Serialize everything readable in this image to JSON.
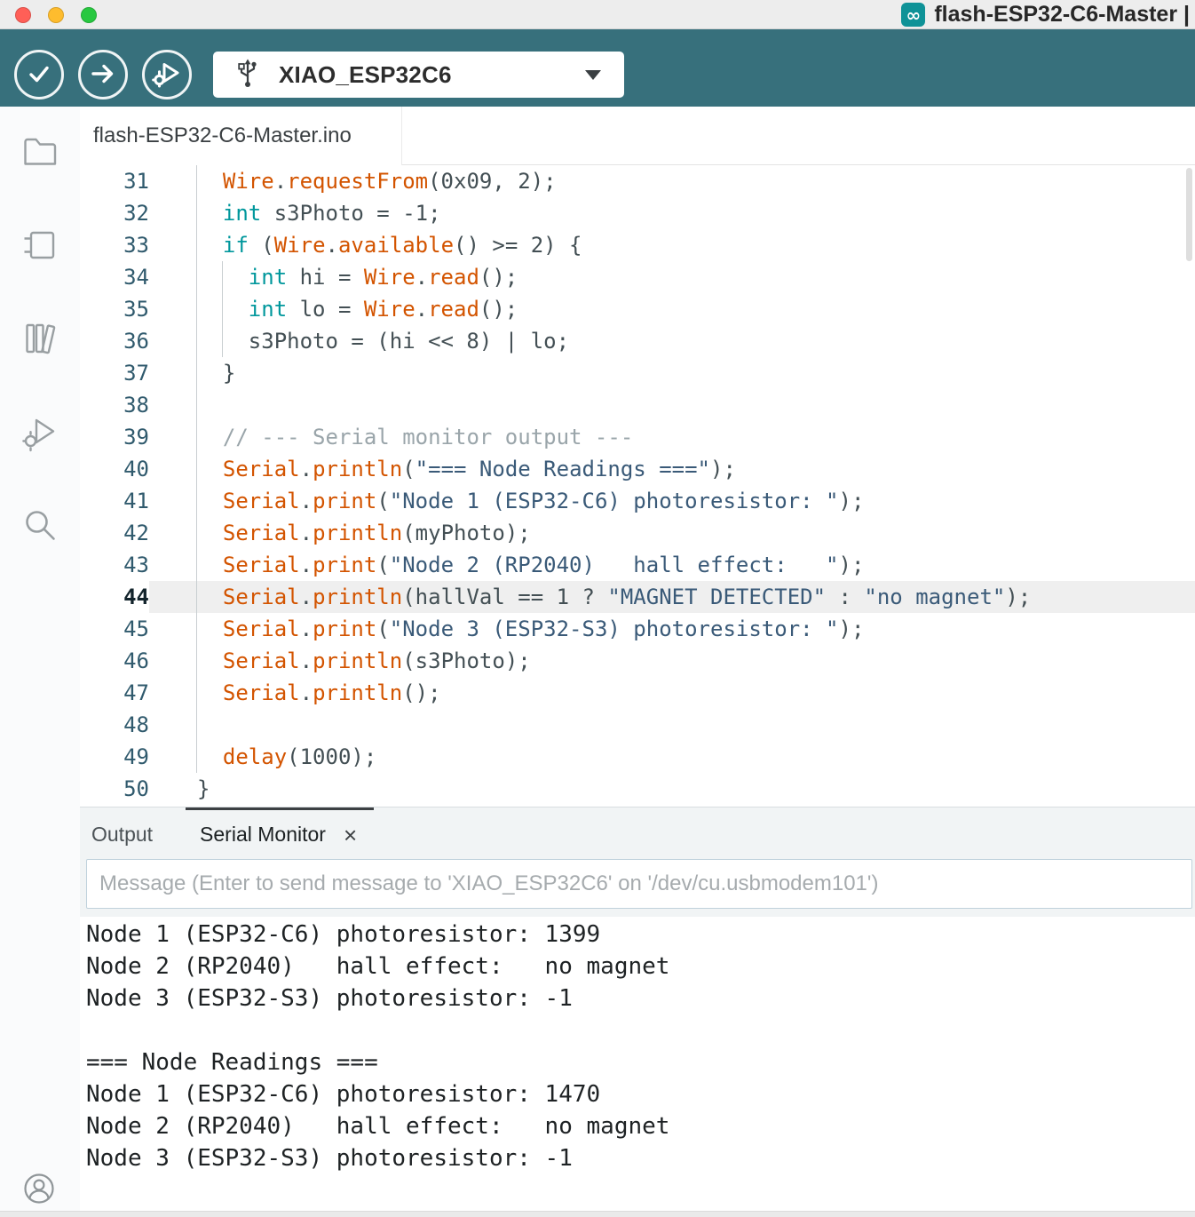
{
  "titlebar": {
    "title": "flash-ESP32-C6-Master |",
    "logo_glyph": "∞"
  },
  "toolbar": {
    "verify_label": "Verify",
    "upload_label": "Upload",
    "debug_label": "Start Debugging",
    "board_selector": {
      "value": "XIAO_ESP32C6"
    }
  },
  "activity_bar": {
    "items": [
      "sketchbook",
      "boards-manager",
      "library-manager",
      "debugger",
      "search"
    ],
    "bottom_item": "profile"
  },
  "editor": {
    "tab_title": "flash-ESP32-C6-Master.ino",
    "active_line": 44,
    "lines": [
      {
        "no": 31,
        "segs": [
          [
            "p",
            "  "
          ],
          [
            "o",
            "Wire"
          ],
          [
            "p",
            "."
          ],
          [
            "o",
            "requestFrom"
          ],
          [
            "p",
            "(0x09, 2);"
          ]
        ]
      },
      {
        "no": 32,
        "segs": [
          [
            "p",
            "  "
          ],
          [
            "k",
            "int"
          ],
          [
            "p",
            " s3Photo = -1;"
          ]
        ]
      },
      {
        "no": 33,
        "segs": [
          [
            "p",
            "  "
          ],
          [
            "k",
            "if"
          ],
          [
            "p",
            " ("
          ],
          [
            "o",
            "Wire"
          ],
          [
            "p",
            "."
          ],
          [
            "o",
            "available"
          ],
          [
            "p",
            "() >= 2) {"
          ]
        ]
      },
      {
        "no": 34,
        "segs": [
          [
            "p",
            "    "
          ],
          [
            "k",
            "int"
          ],
          [
            "p",
            " hi = "
          ],
          [
            "o",
            "Wire"
          ],
          [
            "p",
            "."
          ],
          [
            "o",
            "read"
          ],
          [
            "p",
            "();"
          ]
        ]
      },
      {
        "no": 35,
        "segs": [
          [
            "p",
            "    "
          ],
          [
            "k",
            "int"
          ],
          [
            "p",
            " lo = "
          ],
          [
            "o",
            "Wire"
          ],
          [
            "p",
            "."
          ],
          [
            "o",
            "read"
          ],
          [
            "p",
            "();"
          ]
        ]
      },
      {
        "no": 36,
        "segs": [
          [
            "p",
            "    s3Photo = (hi << 8) | lo;"
          ]
        ]
      },
      {
        "no": 37,
        "segs": [
          [
            "p",
            "  }"
          ]
        ]
      },
      {
        "no": 38,
        "segs": []
      },
      {
        "no": 39,
        "segs": [
          [
            "p",
            "  "
          ],
          [
            "c",
            "// --- Serial monitor output ---"
          ]
        ]
      },
      {
        "no": 40,
        "segs": [
          [
            "p",
            "  "
          ],
          [
            "o",
            "Serial"
          ],
          [
            "p",
            "."
          ],
          [
            "o",
            "println"
          ],
          [
            "p",
            "("
          ],
          [
            "s",
            "\"=== Node Readings ===\""
          ],
          [
            "p",
            ");"
          ]
        ]
      },
      {
        "no": 41,
        "segs": [
          [
            "p",
            "  "
          ],
          [
            "o",
            "Serial"
          ],
          [
            "p",
            "."
          ],
          [
            "o",
            "print"
          ],
          [
            "p",
            "("
          ],
          [
            "s",
            "\"Node 1 (ESP32-C6) photoresistor: \""
          ],
          [
            "p",
            ");"
          ]
        ]
      },
      {
        "no": 42,
        "segs": [
          [
            "p",
            "  "
          ],
          [
            "o",
            "Serial"
          ],
          [
            "p",
            "."
          ],
          [
            "o",
            "println"
          ],
          [
            "p",
            "(myPhoto);"
          ]
        ]
      },
      {
        "no": 43,
        "segs": [
          [
            "p",
            "  "
          ],
          [
            "o",
            "Serial"
          ],
          [
            "p",
            "."
          ],
          [
            "o",
            "print"
          ],
          [
            "p",
            "("
          ],
          [
            "s",
            "\"Node 2 (RP2040)   hall effect:   \""
          ],
          [
            "p",
            ");"
          ]
        ]
      },
      {
        "no": 44,
        "segs": [
          [
            "p",
            "  "
          ],
          [
            "o",
            "Serial"
          ],
          [
            "p",
            "."
          ],
          [
            "o",
            "println"
          ],
          [
            "p",
            "(hallVal == 1 ? "
          ],
          [
            "s",
            "\"MAGNET DETECTED\""
          ],
          [
            "p",
            " : "
          ],
          [
            "s",
            "\"no magnet\""
          ],
          [
            "p",
            ");"
          ]
        ]
      },
      {
        "no": 45,
        "segs": [
          [
            "p",
            "  "
          ],
          [
            "o",
            "Serial"
          ],
          [
            "p",
            "."
          ],
          [
            "o",
            "print"
          ],
          [
            "p",
            "("
          ],
          [
            "s",
            "\"Node 3 (ESP32-S3) photoresistor: \""
          ],
          [
            "p",
            ");"
          ]
        ]
      },
      {
        "no": 46,
        "segs": [
          [
            "p",
            "  "
          ],
          [
            "o",
            "Serial"
          ],
          [
            "p",
            "."
          ],
          [
            "o",
            "println"
          ],
          [
            "p",
            "(s3Photo);"
          ]
        ]
      },
      {
        "no": 47,
        "segs": [
          [
            "p",
            "  "
          ],
          [
            "o",
            "Serial"
          ],
          [
            "p",
            "."
          ],
          [
            "o",
            "println"
          ],
          [
            "p",
            "();"
          ]
        ]
      },
      {
        "no": 48,
        "segs": []
      },
      {
        "no": 49,
        "segs": [
          [
            "p",
            "  "
          ],
          [
            "o",
            "delay"
          ],
          [
            "p",
            "(1000);"
          ]
        ]
      },
      {
        "no": 50,
        "segs": [
          [
            "p",
            "}"
          ]
        ]
      }
    ]
  },
  "panel": {
    "output_tab": "Output",
    "serial_tab": "Serial Monitor",
    "close_glyph": "×",
    "message_placeholder": "Message (Enter to send message to 'XIAO_ESP32C6' on '/dev/cu.usbmodem101')",
    "serial_lines": [
      "Node 1 (ESP32-C6) photoresistor: 1399",
      "Node 2 (RP2040)   hall effect:   no magnet",
      "Node 3 (ESP32-S3) photoresistor: -1",
      "",
      "=== Node Readings ===",
      "Node 1 (ESP32-C6) photoresistor: 1470",
      "Node 2 (RP2040)   hall effect:   no magnet",
      "Node 3 (ESP32-S3) photoresistor: -1"
    ]
  },
  "colors": {
    "toolbar": "#37707c",
    "logo": "#0f9297",
    "keyword": "#00979c",
    "function": "#d35400",
    "string": "#3a5a78",
    "comment": "#9aa5aa",
    "plain": "#434f54",
    "line_number": "#305a6d",
    "line_number_active": "#13242c",
    "active_line_bg": "#efefef"
  }
}
